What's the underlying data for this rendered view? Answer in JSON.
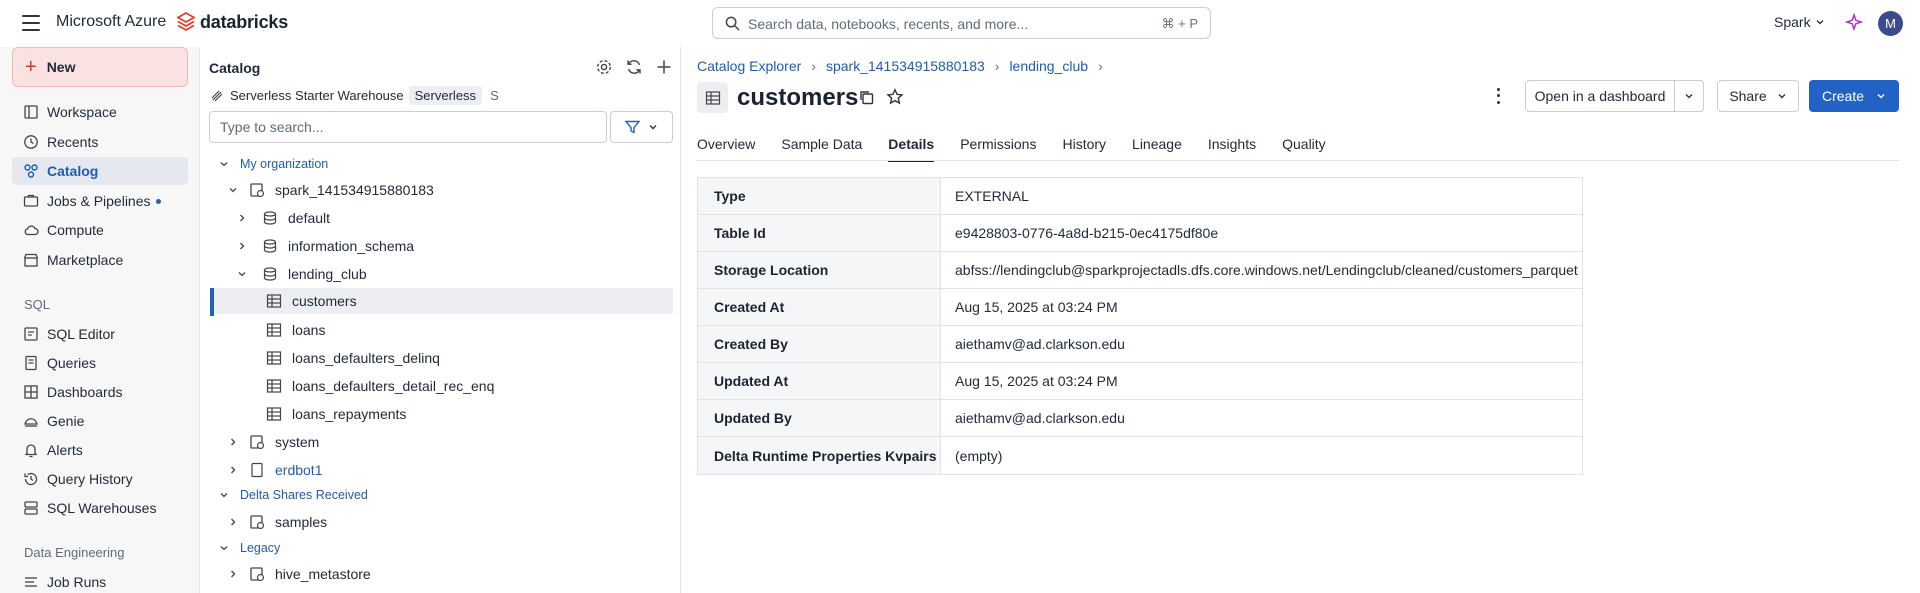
{
  "topbar": {
    "brand": "Microsoft Azure",
    "product": "databricks",
    "search_placeholder": "Search data, notebooks, recents, and more...",
    "search_shortcut": "⌘ + P",
    "workspace": "Spark",
    "avatar_initial": "M"
  },
  "leftnav": {
    "new_label": "New",
    "items": [
      {
        "label": "Workspace"
      },
      {
        "label": "Recents"
      },
      {
        "label": "Catalog"
      },
      {
        "label": "Jobs & Pipelines"
      },
      {
        "label": "Compute"
      },
      {
        "label": "Marketplace"
      }
    ],
    "sql_section": "SQL",
    "sql_items": [
      {
        "label": "SQL Editor"
      },
      {
        "label": "Queries"
      },
      {
        "label": "Dashboards"
      },
      {
        "label": "Genie"
      },
      {
        "label": "Alerts"
      },
      {
        "label": "Query History"
      },
      {
        "label": "SQL Warehouses"
      }
    ],
    "de_section": "Data Engineering",
    "de_items": [
      {
        "label": "Job Runs"
      }
    ]
  },
  "catalog": {
    "title": "Catalog",
    "warehouse": "Serverless Starter Warehouse",
    "warehouse_badge": "Serverless",
    "warehouse_size": "S",
    "search_placeholder": "Type to search...",
    "tree": {
      "my_org": "My organization",
      "spark": "spark_141534915880183",
      "default": "default",
      "information_schema": "information_schema",
      "lending_club": "lending_club",
      "customers": "customers",
      "loans": "loans",
      "loans_defaulters_delinq": "loans_defaulters_delinq",
      "loans_defaulters_detail_rec_enq": "loans_defaulters_detail_rec_enq",
      "loans_repayments": "loans_repayments",
      "system": "system",
      "erdbot1": "erdbot1",
      "delta_shares": "Delta Shares Received",
      "samples": "samples",
      "legacy": "Legacy",
      "hive_metastore": "hive_metastore"
    }
  },
  "main": {
    "breadcrumb": [
      "Catalog Explorer",
      "spark_141534915880183",
      "lending_club"
    ],
    "title": "customers",
    "open_dashboard": "Open in a dashboard",
    "share": "Share",
    "create": "Create",
    "tabs": [
      "Overview",
      "Sample Data",
      "Details",
      "Permissions",
      "History",
      "Lineage",
      "Insights",
      "Quality"
    ],
    "details": [
      {
        "key": "Type",
        "value": "EXTERNAL"
      },
      {
        "key": "Table Id",
        "value": "e9428803-0776-4a8d-b215-0ec4175df80e"
      },
      {
        "key": "Storage Location",
        "value": "abfss://lendingclub@sparkprojectadls.dfs.core.windows.net/Lendingclub/cleaned/customers_parquet"
      },
      {
        "key": "Created At",
        "value": "Aug 15, 2025 at 03:24 PM"
      },
      {
        "key": "Created By",
        "value": "aiethamv@ad.clarkson.edu"
      },
      {
        "key": "Updated At",
        "value": "Aug 15, 2025 at 03:24 PM"
      },
      {
        "key": "Updated By",
        "value": "aiethamv@ad.clarkson.edu"
      },
      {
        "key": "Delta Runtime Properties Kvpairs",
        "value": "(empty)"
      }
    ]
  },
  "colors": {
    "accent": "#2262c5",
    "link": "#1f5dad",
    "new_bg": "#fbe2e2"
  }
}
